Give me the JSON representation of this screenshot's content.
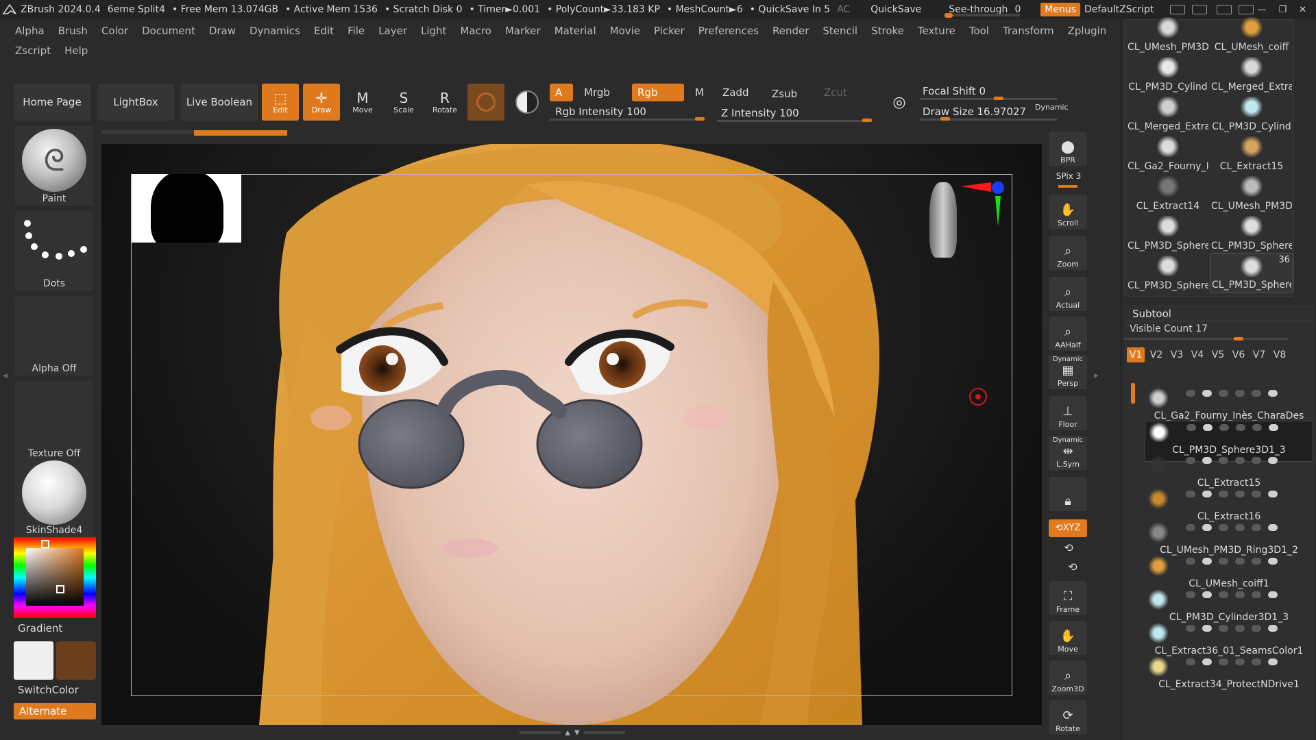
{
  "titlebar": {
    "app": "ZBrush 2024.0.4",
    "doc": "6eme Split4",
    "free_mem": "• Free Mem 13.074GB",
    "active_mem": "• Active Mem 1536",
    "scratch": "• Scratch Disk 0",
    "timer": "• Timer►0.001",
    "polycount": "• PolyCount►33.183 KP",
    "meshcount": "• MeshCount►6",
    "quicksave_in": "• QuickSave In 5",
    "ac": "AC",
    "quicksave": "QuickSave",
    "see_through": "See-through",
    "see_through_value": "0",
    "menus": "Menus",
    "default_zscript": "DefaultZScript",
    "accent_color": "#e07a1f"
  },
  "menubar": {
    "row1": [
      "Alpha",
      "Brush",
      "Color",
      "Document",
      "Draw",
      "Dynamics",
      "Edit",
      "File",
      "Layer",
      "Light",
      "Macro",
      "Marker",
      "Material",
      "Movie",
      "Picker",
      "Preferences",
      "Render",
      "Stencil",
      "Stroke",
      "Texture",
      "Tool",
      "Transform",
      "Zplugin"
    ],
    "row2": [
      "Zscript",
      "Help"
    ]
  },
  "toolbar": {
    "home_page": "Home Page",
    "lightbox": "LightBox",
    "live_boolean": "Live Boolean",
    "edit": "Edit",
    "draw": "Draw",
    "move": "Move",
    "scale": "Scale",
    "rotate": "Rotate",
    "a": "A",
    "mrgb": "Mrgb",
    "rgb": "Rgb",
    "m": "M",
    "zadd": "Zadd",
    "zsub": "Zsub",
    "zcut": "Zcut",
    "rgb_intensity": "Rgb Intensity 100",
    "z_intensity": "Z Intensity 100",
    "focal_shift": "Focal Shift 0",
    "draw_size": "Draw Size 16.97027",
    "dynamic": "Dynamic"
  },
  "leftshelf": {
    "brush": "Paint",
    "stroke": "Dots",
    "alpha": "Alpha Off",
    "texture": "Texture Off",
    "material": "SkinShade4",
    "gradient": "Gradient",
    "switchcolor": "SwitchColor",
    "alternate": "Alternate",
    "main_color": "#efefef",
    "secondary_color": "#6b3e1c"
  },
  "righttools": {
    "bpr": "BPR",
    "spix": "SPix 3",
    "scroll": "Scroll",
    "zoom": "Zoom",
    "actual": "Actual",
    "aahalf": "AAHalf",
    "dynamic1": "Dynamic",
    "persp": "Persp",
    "floor": "Floor",
    "dynamic2": "Dynamic",
    "lsym": "L.Sym",
    "xyz": "⟲XYZ",
    "frame": "Frame",
    "move": "Move",
    "zoom3d": "Zoom3D",
    "rotate": "Rotate"
  },
  "toolpalette": {
    "items": [
      "CL_UMesh_PM3D",
      "CL_UMesh_coiff",
      "CL_PM3D_Cylind",
      "CL_Merged_Extra",
      "CL_Merged_Extra",
      "CL_PM3D_Cylind",
      "CL_Ga2_Fourny_I",
      "CL_Extract15",
      "CL_Extract14",
      "CL_UMesh_PM3D",
      "CL_PM3D_Sphere",
      "CL_PM3D_Sphere",
      "CL_PM3D_Sphere",
      "CL_PM3D_Sphere"
    ],
    "selected_badge": "36"
  },
  "subtool": {
    "title": "Subtool",
    "visible_count": "Visible Count 17",
    "tabs": [
      "V1",
      "V2",
      "V3",
      "V4",
      "V5",
      "V6",
      "V7",
      "V8"
    ],
    "items": [
      "CL_Ga2_Fourny_Inès_CharaDes",
      "CL_PM3D_Sphere3D1_3",
      "CL_Extract15",
      "CL_Extract16",
      "CL_UMesh_PM3D_Ring3D1_2",
      "CL_UMesh_coiff1",
      "CL_PM3D_Cylinder3D1_3",
      "CL_Extract36_01_SeamsColor1",
      "CL_Extract34_ProtectNDrive1"
    ]
  }
}
